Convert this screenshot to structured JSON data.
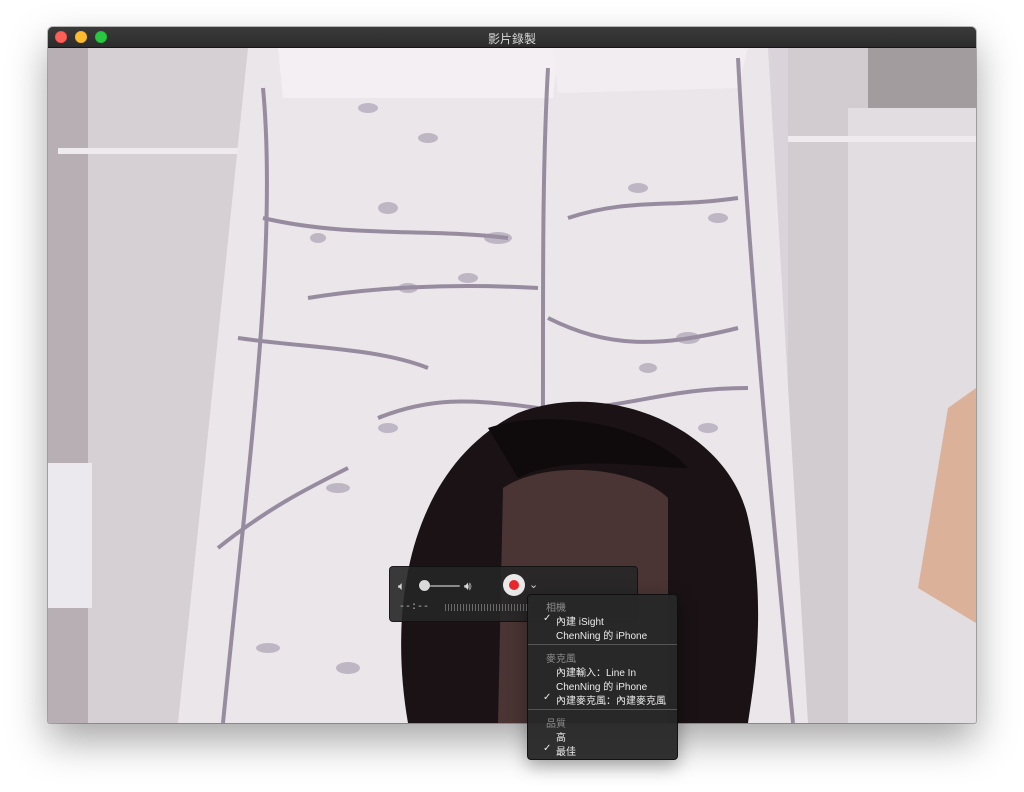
{
  "window": {
    "title": "影片錄製"
  },
  "hud": {
    "volume_low_icon": "speaker-low-icon",
    "volume_high_icon": "speaker-high-icon",
    "record_icon": "record-icon",
    "options_icon": "chevron-down-icon",
    "time": "--:--",
    "volume_level": 0.0
  },
  "menu": {
    "sections": [
      {
        "title": "相機",
        "items": [
          {
            "label": "內建 iSight",
            "checked": true
          },
          {
            "label": "ChenNing 的 iPhone",
            "checked": false
          }
        ]
      },
      {
        "title": "麥克風",
        "items": [
          {
            "label": "內建輸入：Line In",
            "checked": false
          },
          {
            "label": "ChenNing 的 iPhone",
            "checked": false
          },
          {
            "label": "內建麥克風：內建麥克風",
            "checked": true
          }
        ]
      },
      {
        "title": "品質",
        "items": [
          {
            "label": "高",
            "checked": false
          },
          {
            "label": "最佳",
            "checked": true
          }
        ]
      }
    ],
    "check_glyph": "✓"
  },
  "colors": {
    "record": "#e8262b",
    "close": "#fe5f57",
    "minimize": "#febc2e",
    "maximize": "#28c840"
  }
}
